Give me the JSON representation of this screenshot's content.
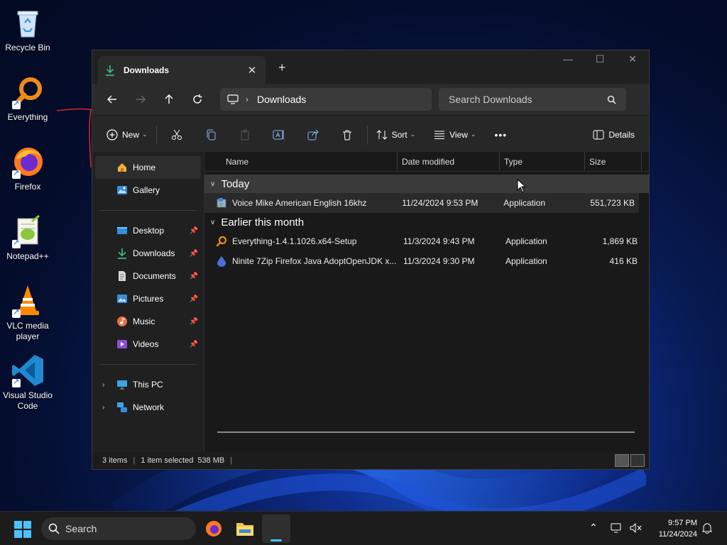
{
  "desktop": {
    "icons": [
      {
        "label": "Recycle Bin",
        "icon": "recycle-bin-icon"
      },
      {
        "label": "Everything",
        "icon": "everything-icon"
      },
      {
        "label": "Firefox",
        "icon": "firefox-icon"
      },
      {
        "label": "Notepad++",
        "icon": "notepadpp-icon"
      },
      {
        "label": "VLC media player",
        "icon": "vlc-icon"
      },
      {
        "label": "Visual Studio Code",
        "icon": "vscode-icon"
      }
    ]
  },
  "window": {
    "tab_title": "Downloads",
    "new_tab_glyph": "+",
    "address": {
      "crumb": "Downloads"
    },
    "search_placeholder": "Search Downloads",
    "commands": {
      "new": "New",
      "sort": "Sort",
      "view": "View",
      "more": "•••",
      "details": "Details"
    },
    "nav": {
      "home": "Home",
      "gallery": "Gallery",
      "pinned": [
        {
          "label": "Desktop"
        },
        {
          "label": "Downloads"
        },
        {
          "label": "Documents"
        },
        {
          "label": "Pictures"
        },
        {
          "label": "Music"
        },
        {
          "label": "Videos"
        }
      ],
      "this_pc": "This PC",
      "network": "Network"
    },
    "columns": {
      "name": "Name",
      "date": "Date modified",
      "type": "Type",
      "size": "Size"
    },
    "groups": [
      {
        "label": "Today",
        "files": [
          {
            "name": "Voice Mike American English 16khz",
            "date": "11/24/2024 9:53 PM",
            "type": "Application",
            "size": "551,723 KB"
          }
        ]
      },
      {
        "label": "Earlier this month",
        "files": [
          {
            "name": "Everything-1.4.1.1026.x64-Setup",
            "date": "11/3/2024 9:43 PM",
            "type": "Application",
            "size": "1,869 KB"
          },
          {
            "name": "Ninite 7Zip Firefox Java AdoptOpenJDK x...",
            "date": "11/3/2024 9:30 PM",
            "type": "Application",
            "size": "416 KB"
          }
        ]
      }
    ],
    "status": {
      "items": "3 items",
      "selected": "1 item selected",
      "size": "538 MB"
    }
  },
  "taskbar": {
    "search_label": "Search",
    "time": "9:57 PM",
    "date": "11/24/2024"
  },
  "colors": {
    "accent": "#4cc2ff",
    "window_bg": "#1c1c1c",
    "annotation": "#d9262b"
  }
}
